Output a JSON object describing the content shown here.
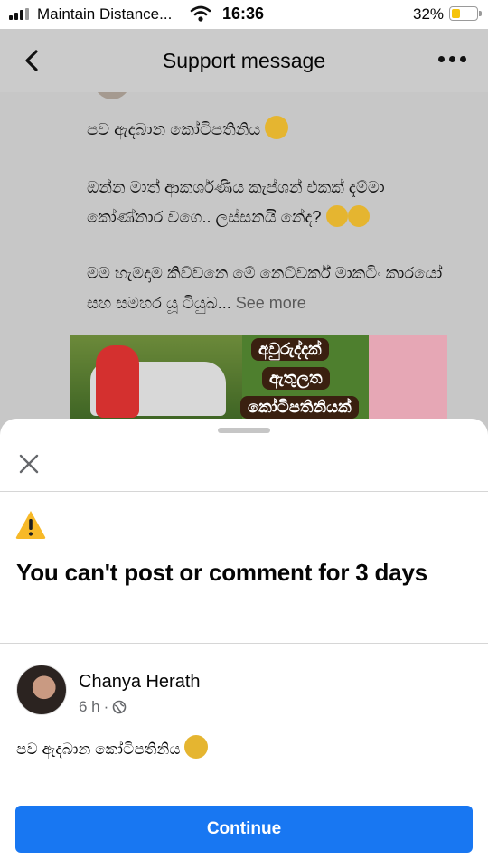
{
  "status_bar": {
    "carrier": "Maintain Distance...",
    "time": "16:36",
    "battery": "32%"
  },
  "header": {
    "title": "Support message"
  },
  "background_post": {
    "line1": "පව ඇදබාන කෝටිපතිනිය",
    "line2": "ඔන්න මාත් ආකර්ශණිය කැප්ශන් එකක් දැම්මා කෝණ්නාර වගෙ.. ලස්සනයි නේද?",
    "line3": "මම හැමදාම කිව්වනෙ මේ නෙට්වර්ක් මාකටිං කාරයෝ සහ සමහර යූ ටියුබ...",
    "see_more": "See more",
    "image_text": [
      "අවුරුද්දක්",
      "ඇතුලත",
      "කෝටිපතිනියක්"
    ]
  },
  "sheet": {
    "restriction_title": "You can't post or comment for 3 days",
    "author": "Chanya Herath",
    "time": "6 h",
    "post_text": "පව ඇදබාන කෝටිපතිනිය",
    "continue_label": "Continue"
  },
  "colors": {
    "primary": "#1877f2",
    "warning": "#f7b928",
    "overlay": "#c9c9c9"
  },
  "icons": [
    "signal-icon",
    "wifi-icon",
    "battery-icon",
    "back-chevron-icon",
    "more-options-icon",
    "close-icon",
    "warning-icon",
    "globe-icon",
    "emoji-icon"
  ]
}
